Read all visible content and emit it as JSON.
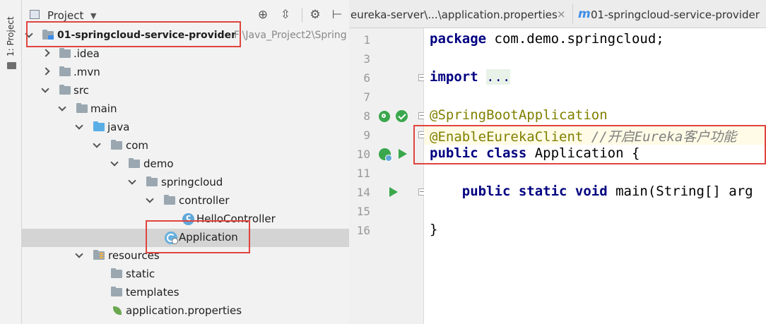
{
  "sidebar_strip": {
    "label": "1: Project"
  },
  "project_panel": {
    "title": "Project",
    "tree": {
      "root": {
        "label": "01-springcloud-service-provider",
        "path": "F:\\Java_Project2\\Spring"
      },
      "idea": ".idea",
      "mvn": ".mvn",
      "src": "src",
      "main": "main",
      "java": "java",
      "com": "com",
      "demo": "demo",
      "springcloud": "springcloud",
      "controller": "controller",
      "hello_controller": "HelloController",
      "application": "Application",
      "resources": "resources",
      "static": "static",
      "templates": "templates",
      "application_properties": "application.properties"
    }
  },
  "editor_tabs": [
    {
      "label": "eureka-server\\...\\application.properties",
      "close": "×"
    },
    {
      "prefix": "m",
      "label": "01-springcloud-service-provider"
    }
  ],
  "line_numbers": [
    "1",
    "3",
    "6",
    "7",
    "8",
    "9",
    "10",
    "11",
    "14",
    "15",
    "16"
  ],
  "code": {
    "l1_kw": "package",
    "l1_rest": " com.demo.springcloud;",
    "l3_kw": "import",
    "l3_dots": "...",
    "l7_ann": "@SpringBootApplication",
    "l8_ann": "@EnableEurekaClient",
    "l8_cmt": " //开启Eureka客户功能",
    "l9_kw": "public class",
    "l9_rest": " Application {",
    "l11_kw": "public static void",
    "l11_rest": " main(String[] arg",
    "l15": "}"
  },
  "colors": {
    "highlight_box": "#e0443e",
    "keyword": "#000080",
    "annotation": "#808000",
    "comment": "#808080"
  }
}
